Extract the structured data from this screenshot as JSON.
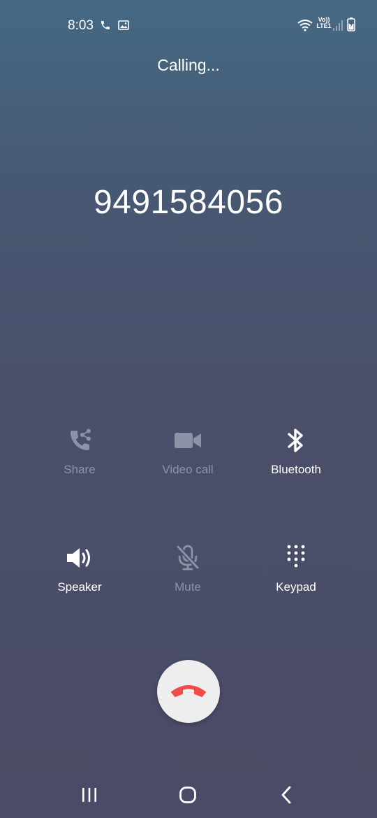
{
  "status_bar": {
    "time": "8:03",
    "icons": [
      "phone-icon",
      "image-icon",
      "wifi-icon",
      "volte-lte-icon",
      "signal-icon",
      "battery-icon"
    ],
    "network_label_top": "Vo))",
    "network_label_bottom": "LTE1"
  },
  "call": {
    "status": "Calling...",
    "number": "9491584056"
  },
  "actions": [
    {
      "label": "Share",
      "icon": "share-call-icon",
      "enabled": false
    },
    {
      "label": "Video call",
      "icon": "video-camera-icon",
      "enabled": false
    },
    {
      "label": "Bluetooth",
      "icon": "bluetooth-icon",
      "enabled": true
    },
    {
      "label": "Speaker",
      "icon": "speaker-icon",
      "enabled": true
    },
    {
      "label": "Mute",
      "icon": "mic-off-icon",
      "enabled": false
    },
    {
      "label": "Keypad",
      "icon": "keypad-icon",
      "enabled": true
    }
  ],
  "colors": {
    "end_call": "#f04a4a",
    "disabled": "#8d93a6",
    "enabled": "#ffffff"
  },
  "navigation": [
    "recent-apps-icon",
    "home-icon",
    "back-icon"
  ]
}
